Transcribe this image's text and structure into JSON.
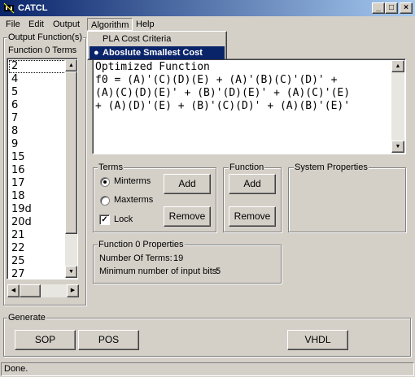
{
  "window": {
    "title": "CATCL",
    "min": "_",
    "max": "□",
    "close": "×"
  },
  "menu": {
    "items": [
      "File",
      "Edit",
      "Output",
      "Algorithm",
      "Help"
    ],
    "dropdown": [
      "PLA Cost Criteria",
      "Aboslute Smallest Cost"
    ],
    "selected_bullet": "●"
  },
  "output": {
    "group_label": "Output Function(s)",
    "list_header": "Function 0 Terms",
    "terms": [
      "2",
      "4",
      "5",
      "6",
      "7",
      "8",
      "9",
      "15",
      "16",
      "17",
      "18",
      "19d",
      "20d",
      "21",
      "22",
      "25",
      "27"
    ]
  },
  "function_text": {
    "lines": [
      "Optimized Function",
      "f0 = (A)'(C)(D)(E) + (A)'(B)(C)'(D)' +",
      "(A)(C)(D)(E)' + (B)'(D)(E)' + (A)(C)'(E)",
      "+ (A)(D)'(E) + (B)'(C)(D)' + (A)(B)'(E)'"
    ]
  },
  "terms_group": {
    "label": "Terms",
    "minterms": "Minterms",
    "maxterms": "Maxterms",
    "lock": "Lock",
    "add": "Add",
    "remove": "Remove",
    "lock_mark": "✓"
  },
  "function_group": {
    "label": "Function",
    "add": "Add",
    "remove": "Remove"
  },
  "system_properties": {
    "label": "System Properties"
  },
  "function_properties": {
    "label": "Function 0 Properties",
    "num_terms_label": "Number Of Terms:",
    "num_terms": "19",
    "min_bits_label": "Minimum number of input bits:",
    "min_bits": "5"
  },
  "generate": {
    "label": "Generate",
    "sop": "SOP",
    "pos": "POS",
    "vhdl": "VHDL"
  },
  "status": {
    "text": "Done."
  },
  "icons": {
    "app": "app-icon",
    "arrow_up": "▲",
    "arrow_down": "▼",
    "arrow_left": "◀",
    "arrow_right": "▶"
  }
}
